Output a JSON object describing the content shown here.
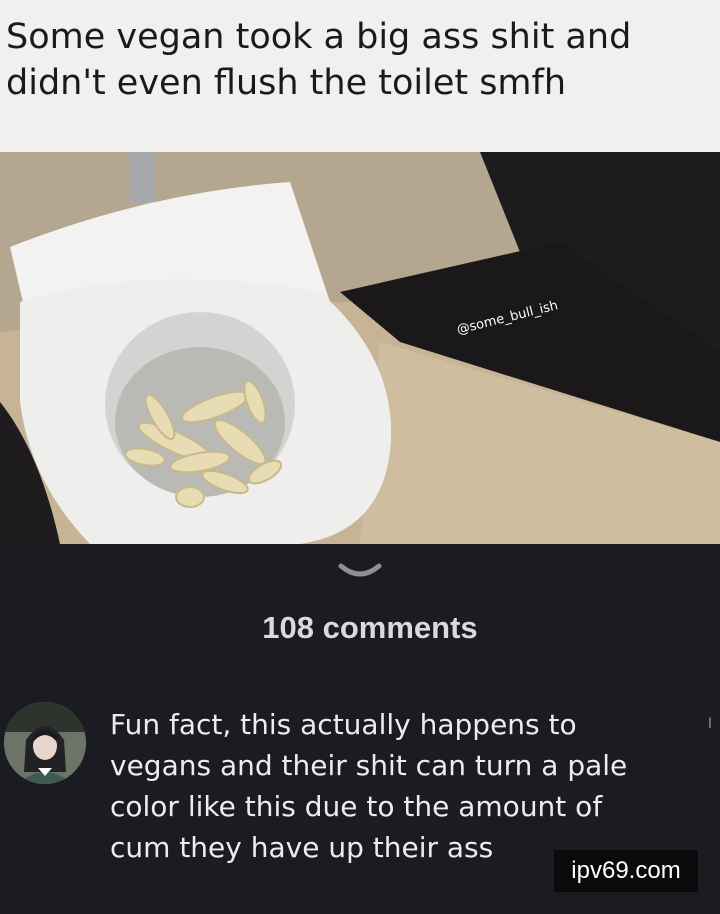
{
  "caption": {
    "text": "Some vegan took a big ass shit and\ndidn't even flush the toilet smfh"
  },
  "photo": {
    "watermark_handle": "@some_bull_ish"
  },
  "comments_section": {
    "collapse_icon": "chevron-down-icon",
    "count_label": "108 comments",
    "comment": {
      "avatar": "anime-character-avatar",
      "text": "Fun fact, this actually happens to vegans and their shit can turn a pale color like this due to the amount of cum they have up their ass",
      "side_mark": "ا"
    }
  },
  "site_watermark": "ipv69.com",
  "colors": {
    "caption_background": "#f0f0f0",
    "comments_background": "#1b1c21",
    "comment_text": "#ececef",
    "count_text": "#d9d9de"
  }
}
